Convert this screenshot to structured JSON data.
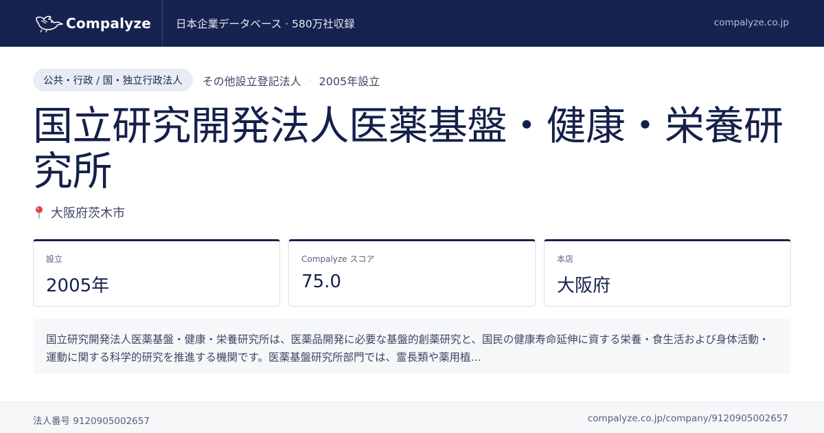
{
  "header": {
    "brand_name": "Compalyze",
    "tagline": "日本企業データベース · 580万社収録",
    "domain": "compalyze.co.jp"
  },
  "meta": {
    "category": "公共・行政 / 国・独立行政法人",
    "entity_type": "その他設立登記法人",
    "separator": "·",
    "founded_text": "2005年設立"
  },
  "company": {
    "name": "国立研究開発法人医薬基盤・健康・栄養研究所",
    "location": "大阪府茨木市"
  },
  "stats": [
    {
      "label": "設立",
      "value": "2005年"
    },
    {
      "label": "Compalyze スコア",
      "value": "75.0"
    },
    {
      "label": "本店",
      "value": "大阪府"
    }
  ],
  "description": "国立研究開発法人医薬基盤・健康・栄養研究所は、医薬品開発に必要な基盤的創薬研究と、国民の健康寿命延伸に資する栄養・食生活および身体活動・運動に関する科学的研究を推進する機関です。医薬基盤研究所部門では、霊長類や薬用植…",
  "footer": {
    "corp_number": "法人番号 9120905002657",
    "url": "compalyze.co.jp/company/9120905002657"
  },
  "icons": {
    "logo": "bird-logo-icon",
    "location": "map-pin-icon"
  },
  "colors": {
    "header_bg": "#16224f",
    "text_primary": "#14204a",
    "pill_bg": "#e8ecf5",
    "pin": "#e0443f"
  }
}
